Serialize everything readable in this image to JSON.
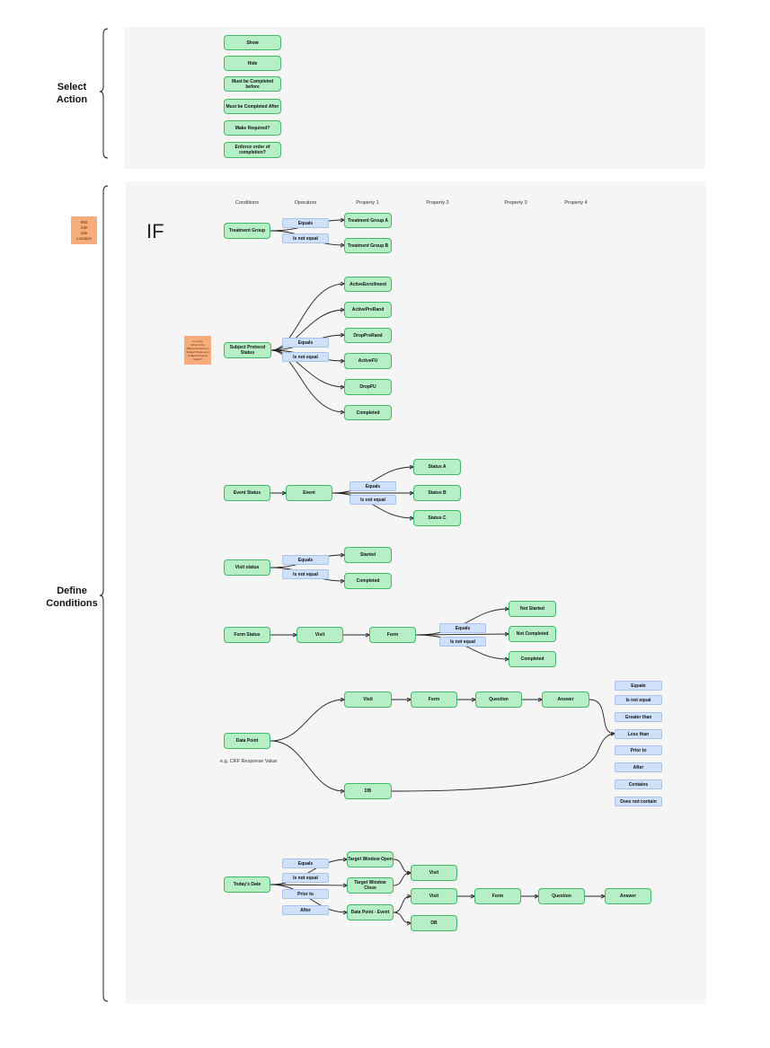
{
  "sections": {
    "select_action": "Select\nAction",
    "define_conditions": "Define\nConditions"
  },
  "actions": [
    "Show",
    "Hide",
    "Must be Completed before",
    "Must be Completed After",
    "Make Required?",
    "Enforce order of completion?"
  ],
  "column_headers": [
    "Conditions",
    "Operators",
    "Property 1",
    "Property 2",
    "Property 3",
    "Property  4"
  ],
  "if_label": "IF",
  "sticky_irb": "IRB\nSite\nSite\nLocation",
  "sticky_note": "Is it wise\nWhat is the\ndifference between\nSubject Status and\nSubject Protocol\nStatus?",
  "operators": {
    "equals": "Equals",
    "not_equal": "Is not equal",
    "prior_to": "Prior to",
    "after": "After"
  },
  "treatment": {
    "condition": "Treatment Group",
    "values": [
      "Treatment Group A",
      "Treatment Group B"
    ]
  },
  "protocol": {
    "condition": "Subject Protocol Status",
    "values": [
      "ActiveEnrollment",
      "ActivePreRand",
      "DropPreRand",
      "ActiveFU",
      "DropFU",
      "Completed"
    ]
  },
  "event": {
    "condition": "Event Status",
    "object": "Event",
    "values": [
      "Status A",
      "Status B",
      "Status C"
    ]
  },
  "visit": {
    "condition": "Visit status",
    "values": [
      "Started",
      "Completed"
    ]
  },
  "form": {
    "condition": "Form Status",
    "chain": [
      "Visit",
      "Form"
    ],
    "values": [
      "Not Started",
      "Not Completed",
      "Completed"
    ]
  },
  "datapoint": {
    "condition": "Data Point",
    "note": "e.g. CRF Response Value",
    "chain": [
      "Visit",
      "Form",
      "Question",
      "Answer"
    ],
    "db": "DB",
    "operators": [
      "Equals",
      "Is not equal",
      "Greater than",
      "Less than",
      "Prior to",
      "After",
      "Contains",
      "Does not contain"
    ]
  },
  "today": {
    "condition": "Today's Date",
    "targets": [
      "Target Window Open",
      "Target Window Close",
      "Data Point - Event"
    ],
    "visit": "Visit",
    "chain": [
      "Visit",
      "Form",
      "Question",
      "Answer"
    ],
    "db": "DB"
  }
}
